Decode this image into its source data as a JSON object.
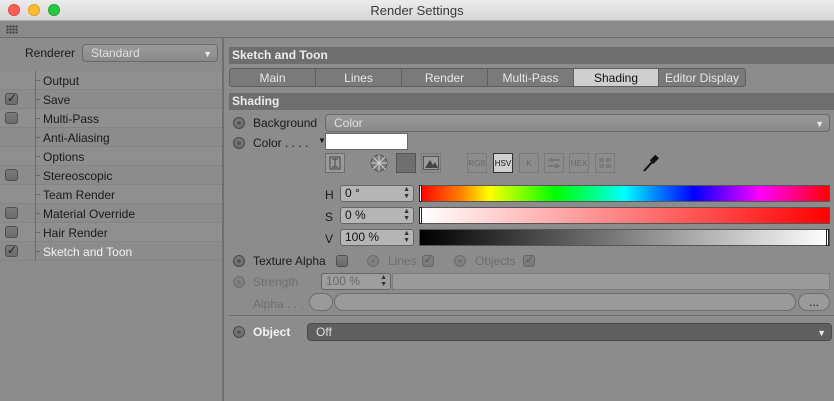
{
  "window": {
    "title": "Render Settings"
  },
  "left": {
    "renderer_label": "Renderer",
    "renderer_value": "Standard",
    "items": [
      {
        "label": "Output",
        "checkbox": null
      },
      {
        "label": "Save",
        "checkbox": true
      },
      {
        "label": "Multi-Pass",
        "checkbox": false
      },
      {
        "label": "Anti-Aliasing",
        "checkbox": null
      },
      {
        "label": "Options",
        "checkbox": null
      },
      {
        "label": "Stereoscopic",
        "checkbox": false
      },
      {
        "label": "Team Render",
        "checkbox": null
      },
      {
        "label": "Material Override",
        "checkbox": false
      },
      {
        "label": "Hair Render",
        "checkbox": false
      },
      {
        "label": "Sketch and Toon",
        "checkbox": true
      }
    ]
  },
  "right": {
    "header": "Sketch and Toon",
    "tabs": [
      {
        "label": "Main",
        "active": false
      },
      {
        "label": "Lines",
        "active": false
      },
      {
        "label": "Render",
        "active": false
      },
      {
        "label": "Multi-Pass",
        "active": false
      },
      {
        "label": "Shading",
        "active": true
      },
      {
        "label": "Editor Display",
        "active": false
      }
    ],
    "section": "Shading",
    "background_label": "Background",
    "background_value": "Color",
    "color_label": "Color . . . .",
    "color_value": "#ffffff",
    "picker_buttons": [
      "RGB",
      "HSV",
      "K",
      "HEX"
    ],
    "h_label": "H",
    "h_value": "0 °",
    "s_label": "S",
    "s_value": "0 %",
    "v_label": "V",
    "v_value": "100 %",
    "texture_alpha_label": "Texture Alpha",
    "lines_label": "Lines",
    "objects_label": "Objects",
    "strength_label": "Strength",
    "strength_value": "100 %",
    "alpha_label": "Alpha . . .",
    "alpha_button": "...",
    "object_label": "Object",
    "object_value": "Off"
  }
}
